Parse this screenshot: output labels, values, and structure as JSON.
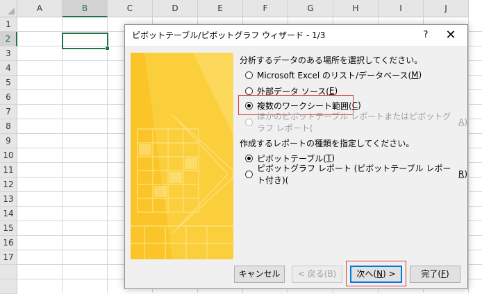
{
  "sheet": {
    "columns": [
      "A",
      "B",
      "C",
      "D",
      "E",
      "F",
      "G",
      "H",
      "I",
      "J"
    ],
    "rows": [
      "1",
      "2",
      "3",
      "4",
      "5",
      "6",
      "7",
      "8",
      "9",
      "10",
      "11",
      "12",
      "13",
      "14",
      "15",
      "16",
      "17"
    ],
    "selected_column": "B",
    "selected_row": "2"
  },
  "dialog": {
    "title": "ピボットテーブル/ピボットグラフ ウィザード - 1/3",
    "help_label": "?",
    "close_label": "✕",
    "source_section_label": "分析するデータのある場所を選択してください。",
    "source_options": [
      {
        "text": "Microsoft Excel のリスト/データベース(",
        "key": "M",
        "end": ")",
        "selected": false,
        "enabled": true
      },
      {
        "text": "外部データ ソース(",
        "key": "E",
        "end": ")",
        "selected": false,
        "enabled": true
      },
      {
        "text": "複数のワークシート範囲(",
        "key": "C",
        "end": ")",
        "selected": true,
        "enabled": true
      },
      {
        "text": "ほかのピボットテーブル レポートまたはピボットグラフ レポート(",
        "key": "A",
        "end": ")",
        "selected": false,
        "enabled": false
      }
    ],
    "report_section_label": "作成するレポートの種類を指定してください。",
    "report_options": [
      {
        "text": "ピボットテーブル(",
        "key": "T",
        "end": ")",
        "selected": true,
        "enabled": true
      },
      {
        "text": "ピボットグラフ レポート (ピボットテーブル レポート付き)(",
        "key": "R",
        "end": ")",
        "selected": false,
        "enabled": true
      }
    ],
    "buttons": {
      "cancel": "キャンセル",
      "back": "< 戻る(B)",
      "next_pre": "次へ(",
      "next_key": "N",
      "next_post": ") >",
      "finish_pre": "完了(",
      "finish_key": "F",
      "finish_post": ")"
    }
  },
  "colors": {
    "excel_green": "#217346",
    "highlight_red": "#d63b3b",
    "wizard_yellow": "#fbc529",
    "default_button_blue": "#0078d7"
  }
}
